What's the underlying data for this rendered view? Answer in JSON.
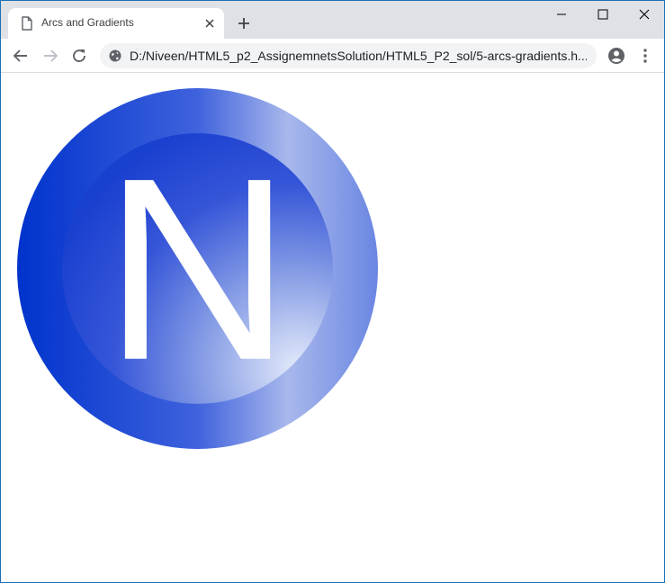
{
  "browser": {
    "tab": {
      "title": "Arcs and Gradients",
      "icon": "page-icon"
    },
    "address": {
      "url": "D:/Niveen/HTML5_p2_AssignemnetsSolution/HTML5_P2_sol/5-arcs-gradients.h...",
      "icon": "file-globe-icon"
    }
  },
  "canvas": {
    "letter": "N",
    "colors": {
      "outer_dark": "#0033cc",
      "outer_light": "#a8b8ec",
      "inner_dark": "#1a40d0",
      "inner_light": "#e4eafa",
      "text": "#ffffff"
    }
  }
}
